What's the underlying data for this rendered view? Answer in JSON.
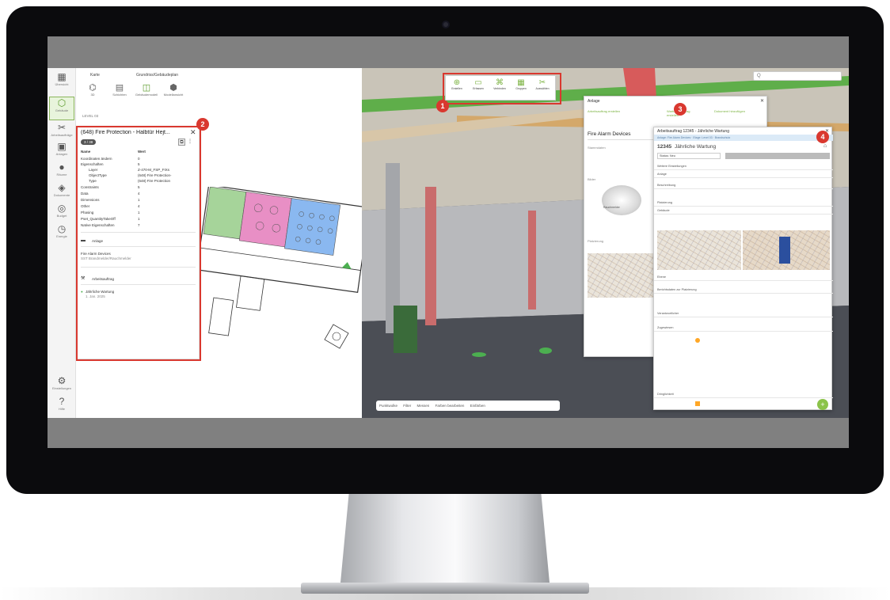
{
  "left_panel": {
    "tabs": [
      "Karte",
      "Grundriss/Gebäudeplan"
    ],
    "modes": [
      "3D",
      "Schichten",
      "Gebäudemodell",
      "Modellansicht"
    ],
    "level": "LEVEL 03",
    "title": "(648) Fire Protection - Halbtür Hejt...",
    "chip": "3 / 38",
    "col_name": "Name",
    "col_value": "Wert",
    "rows": [
      {
        "k": "Koordinaten ändern",
        "v": "0"
      },
      {
        "k": "Eigenschaften",
        "v": "5"
      },
      {
        "k": "Layer",
        "v": "Z-470-M_FSP_FIXs"
      },
      {
        "k": "ObjectType",
        "v": "(648) Fire Protection-"
      },
      {
        "k": "Type",
        "v": "(648) Fire Protection"
      },
      {
        "k": "Constraints",
        "v": "5"
      },
      {
        "k": "Data",
        "v": "4"
      },
      {
        "k": "Dimensions",
        "v": "1"
      },
      {
        "k": "Other",
        "v": "4"
      },
      {
        "k": "Phasing",
        "v": "1"
      },
      {
        "k": "Pset_QuantityTakeOff",
        "v": "1"
      },
      {
        "k": "Native Eigenschaften",
        "v": "7"
      }
    ],
    "asset_label": "Anlage",
    "asset_name": "Fire Alarm Devices",
    "asset_desc": "SST Brandmelder/Rauchmelder",
    "workorder_label": "Arbeitsauftrag",
    "workorder_item": "Jährliche Wartung",
    "workorder_date": "1. Jan. 2025"
  },
  "rail": [
    {
      "icon": "grid-icon",
      "glyph": "▦",
      "label": "Übersicht"
    },
    {
      "icon": "building-icon",
      "glyph": "⬡",
      "label": "Gebäude"
    },
    {
      "icon": "tools-icon",
      "glyph": "✂",
      "label": "Arbeitsaufträge"
    },
    {
      "icon": "assets-icon",
      "glyph": "▣",
      "label": "Anlagen"
    },
    {
      "icon": "rooms-icon",
      "glyph": "●",
      "label": "Räume"
    },
    {
      "icon": "documents-icon",
      "glyph": "◈",
      "label": "Dokumente"
    },
    {
      "icon": "budget-icon",
      "glyph": "◎",
      "label": "Budget"
    },
    {
      "icon": "energy-icon",
      "glyph": "◷",
      "label": "Energie"
    },
    {
      "icon": "settings-icon",
      "glyph": "⚙",
      "label": "Einstellungen"
    },
    {
      "icon": "help-icon",
      "glyph": "?",
      "label": "Hilfe"
    }
  ],
  "toolbar3d": [
    "Erstellen",
    "Erfassen",
    "Verbinden",
    "Gruppen",
    "Auswählen"
  ],
  "search_placeholder": "Q",
  "bottombar": [
    "Punktwolke",
    "Filter",
    "Messen",
    "Farben bearbeiten",
    "Einfärben"
  ],
  "asset_panel": {
    "title": "Anlage",
    "actions": [
      "Arbeitsauftrag erstellen",
      "Wartungsauftrag erstellen",
      "Dokument hinzufügen"
    ],
    "name": "Fire Alarm Devices",
    "section_details": "Stammdaten",
    "section_description": "Beschreibung",
    "section_picture": "Bilder",
    "section_location": "Platzierung",
    "device_label": "Rauchmelder"
  },
  "work_panel": {
    "header": "Arbeitsauftrag 12345 - Jährliche Wartung",
    "subheader": "Anlage: Fire Alarm Devices · Etage: Level 03 · Brandschutz",
    "id": "12345",
    "title": "Jährliche Wartung",
    "status_label": "Status",
    "status_value": "Neu",
    "rows": [
      "Weitere Einstellungen",
      "Anlage",
      "Beschreibung",
      "Platzierung",
      "Gebäude",
      "Ebene",
      "Berichtsdaten zur Platzierung",
      "Verantwortlicher",
      "Zugewiesen",
      "Dringlichkeit"
    ],
    "fab": "+"
  },
  "annotations": [
    "1",
    "2",
    "3",
    "4"
  ],
  "colors": {
    "accent": "#7cb342",
    "annotation": "#d9382f",
    "zone_green": "#a6d49a",
    "zone_pink": "#e88fc5",
    "zone_blue": "#8ab8f0"
  }
}
